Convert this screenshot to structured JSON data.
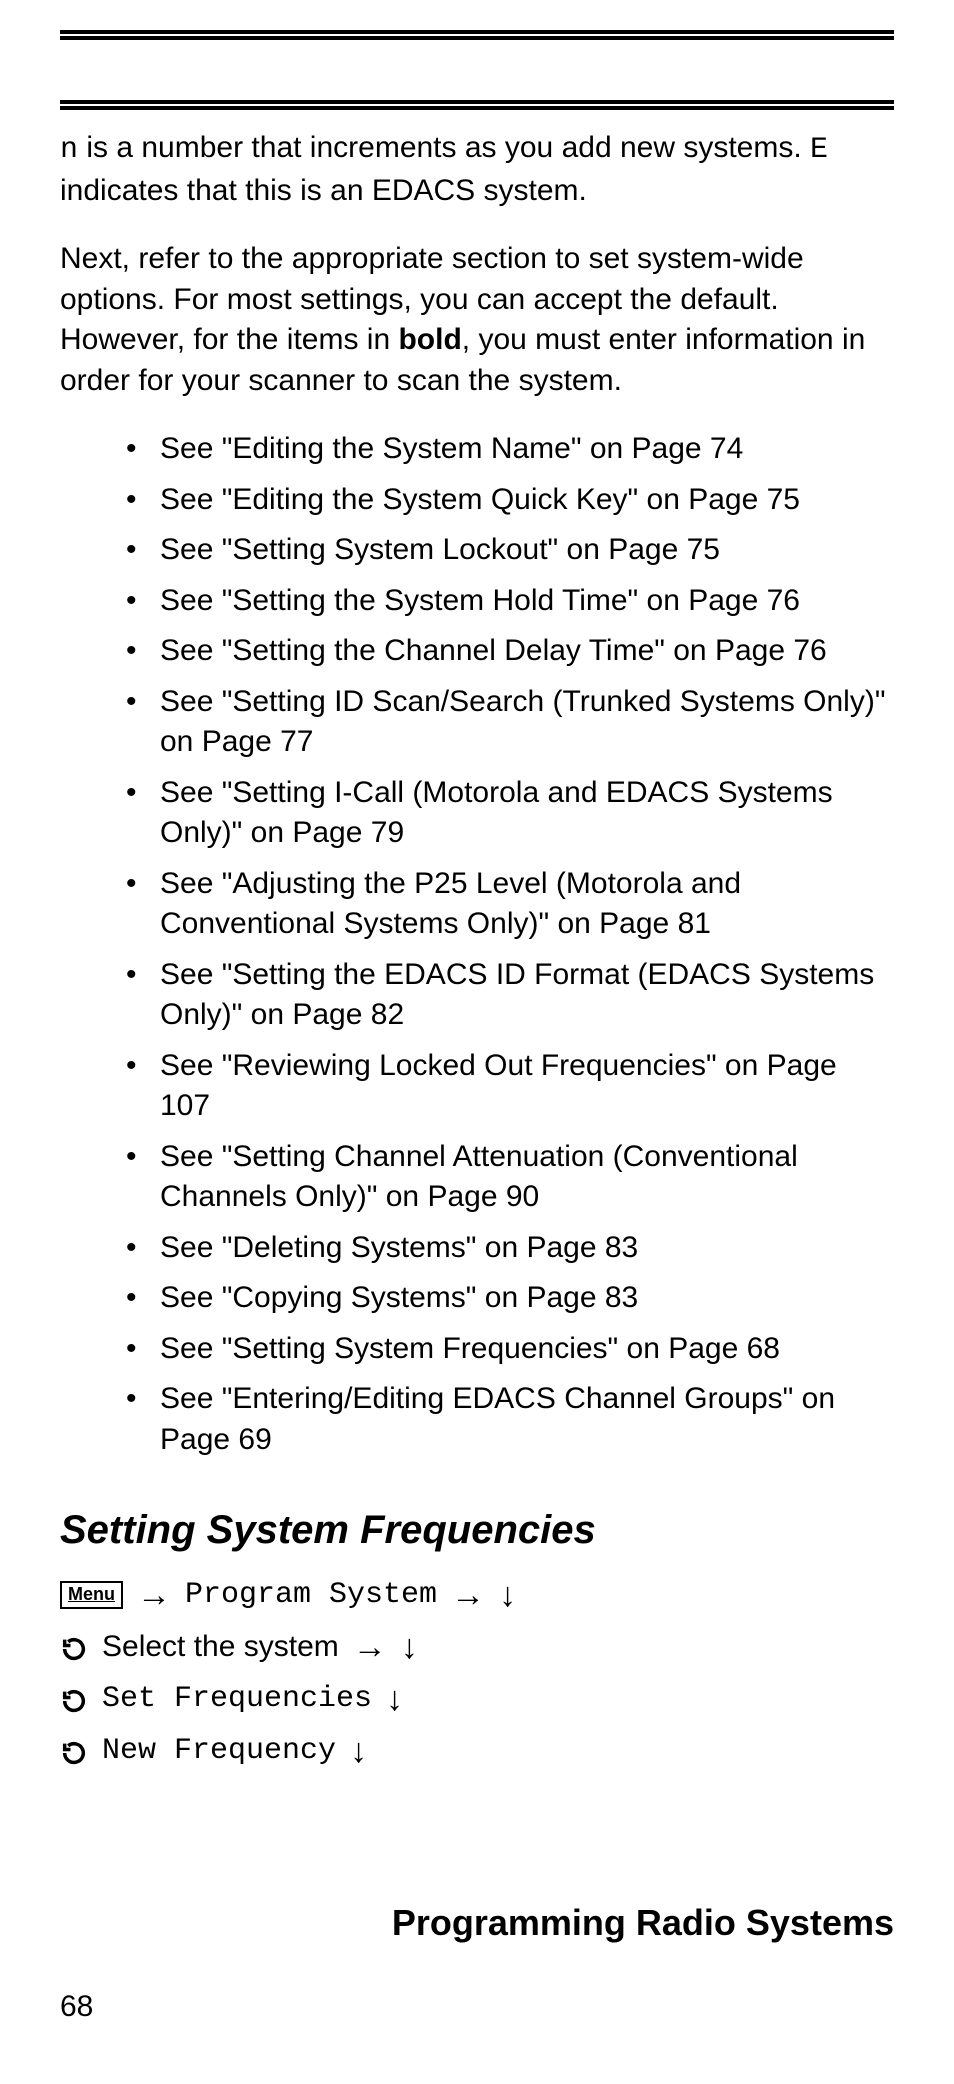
{
  "paragraph1": {
    "pre_n": "",
    "n": "n",
    "after_n": " is a number that increments as you add new systems. ",
    "e": "E",
    "after_e": " indicates that this is an EDACS system."
  },
  "paragraph2": {
    "pre": "Next, refer to the appropriate section to set system-wide options. For most settings, you can accept the default. However, for the items in ",
    "bold": "bold",
    "post": ", you must enter information in order for your scanner to scan the system."
  },
  "refs": [
    "See \"Editing the System Name\" on Page 74",
    "See \"Editing the System Quick Key\" on Page 75",
    "See \"Setting System Lockout\" on Page 75",
    "See \"Setting the System Hold Time\" on Page 76",
    "See \"Setting the Channel Delay Time\" on Page 76",
    "See \"Setting ID Scan/Search (Trunked Systems Only)\" on Page 77",
    "See \"Setting I-Call (Motorola and EDACS Systems Only)\" on Page 79",
    "See \"Adjusting the P25 Level (Motorola and Conventional Systems Only)\" on Page 81",
    "See \"Setting the EDACS ID Format (EDACS Systems Only)\" on Page 82",
    "See \"Reviewing Locked Out Frequencies\" on Page 107",
    "See \"Setting Channel Attenuation (Conventional Channels Only)\" on Page 90",
    "See \"Deleting Systems\" on Page 83",
    "See \"Copying Systems\" on Page 83",
    "See \"Setting System Frequencies\" on Page 68",
    "See \"Entering/Editing EDACS Channel Groups\" on Page 69"
  ],
  "section_heading": "Setting System Frequencies",
  "nav": {
    "menu_label": "Menu",
    "program_system": "Program System",
    "select_system": "Select the system",
    "set_frequencies": "Set Frequencies",
    "new_frequency": "New Frequency"
  },
  "footer_title": "Programming Radio Systems",
  "page_number": "68"
}
